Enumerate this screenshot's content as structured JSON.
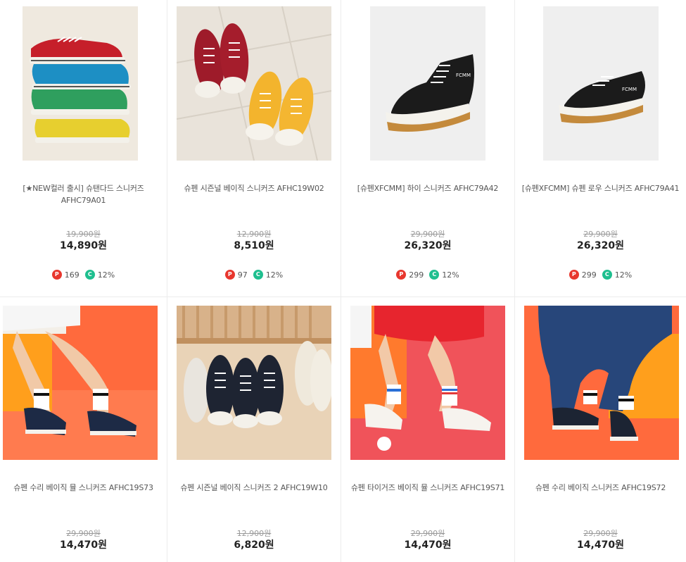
{
  "products": [
    {
      "name": "[★NEW컬러 출시] 슈탠다드 스니커즈 AFHC79A01",
      "original_price": "19,900원",
      "price": "14,890원",
      "points": "169",
      "discount": "12%",
      "image": "stacked-color-sneakers"
    },
    {
      "name": "슈펜 시즌널 베이직 스니커즈 AFHC19W02",
      "original_price": "12,900원",
      "price": "8,510원",
      "points": "97",
      "discount": "12%",
      "image": "red-yellow-sneakers-on-tile"
    },
    {
      "name": "[슈펜XFCMM] 하이 스니커즈 AFHC79A42",
      "original_price": "29,900원",
      "price": "26,320원",
      "points": "299",
      "discount": "12%",
      "image": "black-high-top-sneaker"
    },
    {
      "name": "[슈펜XFCMM] 슈펜 로우 스니커즈 AFHC79A41",
      "original_price": "29,900원",
      "price": "26,320원",
      "points": "299",
      "discount": "12%",
      "image": "black-low-top-sneaker"
    },
    {
      "name": "슈펜 수리 베이직 뮬 스니커즈 AFHC19S73",
      "original_price": "29,900원",
      "price": "14,470원",
      "image": "model-navy-mule-orange-bg"
    },
    {
      "name": "슈펜 시즌널 베이직 스니커즈 2 AFHC19W10",
      "original_price": "12,900원",
      "price": "6,820원",
      "image": "sneaker-lineup-wood-bench"
    },
    {
      "name": "슈펜 타이거즈 베이직 뮬 스니커즈 AFHC19S71",
      "original_price": "29,900원",
      "price": "14,470원",
      "image": "model-white-mule-red-bg"
    },
    {
      "name": "슈펜 수리 베이직 스니커즈 AFHC19S72",
      "original_price": "29,900원",
      "price": "14,470원",
      "image": "model-denim-navy-sneaker-orange-bg"
    }
  ],
  "badge_icons": {
    "points": "P",
    "coupon": "C"
  },
  "colors": {
    "points_badge": "#e8372e",
    "coupon_badge": "#1fbf8f"
  }
}
